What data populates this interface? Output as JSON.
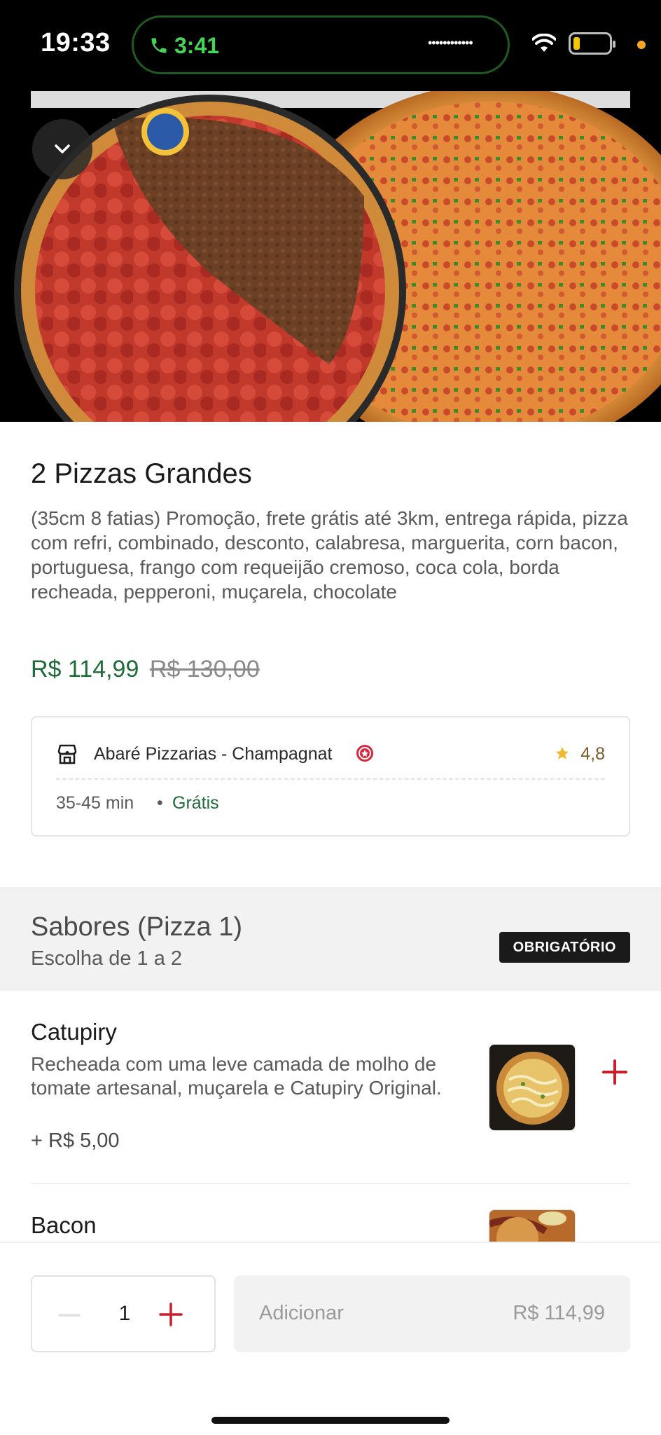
{
  "status_bar": {
    "time": "19:33",
    "call_time": "3:41",
    "signal_dots": "••••••••••••",
    "icons": [
      "phone-icon",
      "wifi-icon",
      "battery-icon"
    ]
  },
  "hero": {
    "collapse_icon": "chevron-down-icon",
    "image_alt": "pizza-photo"
  },
  "product": {
    "title": "2 Pizzas Grandes",
    "description": "(35cm 8 fatias) Promoção, frete grátis até 3km, entrega rápida, pizza com refri, combinado, desconto, calabresa, marguerita, corn bacon, portuguesa, frango com requeijão cremoso, coca cola, borda recheada, pepperoni, muçarela, chocolate",
    "price_current": "R$ 114,99",
    "price_original": "R$ 130,00"
  },
  "store": {
    "name": "Abaré Pizzarias - Champagnat",
    "rating": "4,8",
    "delivery_time": "35-45 min",
    "separator": "•",
    "delivery_fee": "Grátis"
  },
  "section": {
    "title": "Sabores (Pizza 1)",
    "subtitle": "Escolha de 1 a 2",
    "badge": "OBRIGATÓRIO"
  },
  "options": [
    {
      "name": "Catupiry",
      "description": "Recheada com uma leve camada de molho de tomate artesanal, muçarela e Catupiry Original.",
      "price": "+ R$ 5,00"
    },
    {
      "name": "Bacon"
    }
  ],
  "bottom": {
    "quantity": "1",
    "add_label": "Adicionar",
    "add_price": "R$ 114,99"
  },
  "colors": {
    "accent_green": "#1f6b3a",
    "accent_red": "#c8202a",
    "badge_bg": "#1a1a1a"
  }
}
